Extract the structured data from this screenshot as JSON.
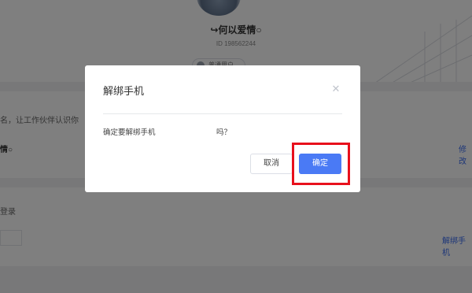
{
  "profile": {
    "username": "↪何以爱情○",
    "user_id": "ID 198562244",
    "badge": "普通用户"
  },
  "section1": {
    "description": "名，让工作伙伴认识你",
    "name_value": "情○",
    "edit_link": "修改"
  },
  "section2": {
    "label": "登录",
    "unbind_link": "解绑手机"
  },
  "dialog": {
    "title": "解绑手机",
    "close_icon": "close-icon",
    "message": "确定要解绑手机",
    "message_tail": "吗？",
    "cancel_label": "取消",
    "confirm_label": "确定"
  },
  "colors": {
    "primary": "#4a7af5",
    "highlight": "#e8101c",
    "overlay": "rgba(0,0,0,0.5)"
  }
}
